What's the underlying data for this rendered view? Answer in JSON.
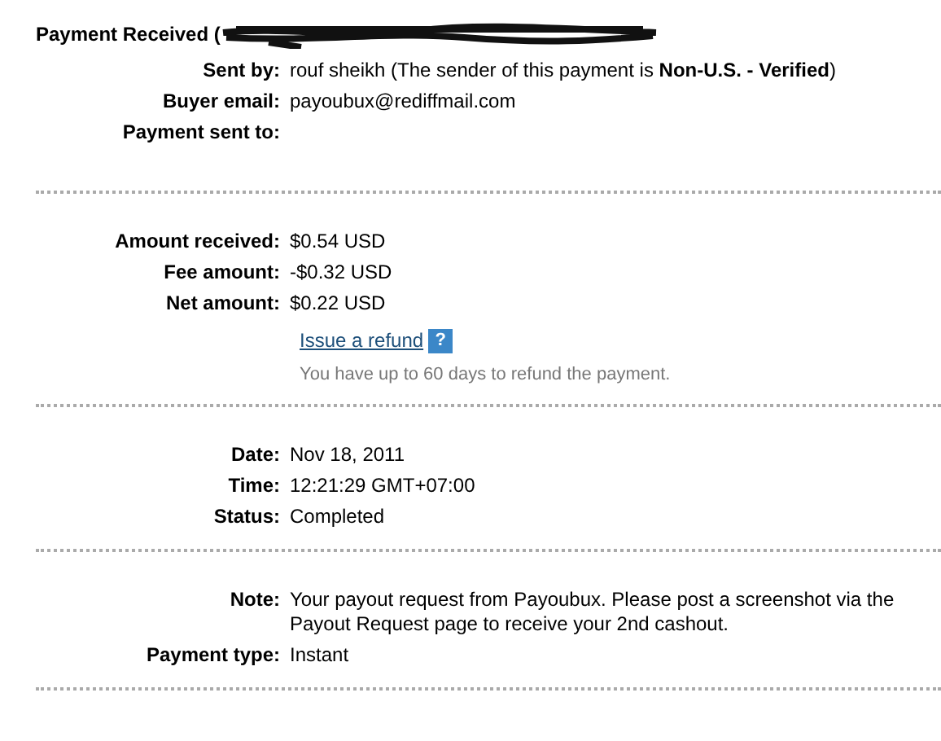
{
  "title": "Payment Received (",
  "sections": [
    {
      "rows": [
        {
          "kind": "field",
          "label": "Sent by:",
          "value": "rouf sheikh (The sender of this payment is **Non-U.S. - Verified**)"
        },
        {
          "kind": "field",
          "label": "Buyer email:",
          "value": "payoubux@rediffmail.com"
        },
        {
          "kind": "field",
          "label": "Payment sent to:"
        }
      ]
    },
    {
      "rows": [
        {
          "kind": "field",
          "label": "Amount received:",
          "value": "$0.54 USD"
        },
        {
          "kind": "field",
          "label": "Fee amount:",
          "value": "-$0.32 USD"
        },
        {
          "kind": "field",
          "label": "Net amount:",
          "value": "$0.22 USD"
        },
        {
          "kind": "refund",
          "link": "Issue a refund",
          "help": "?",
          "hint": "You have up to 60 days to refund the payment."
        }
      ]
    },
    {
      "rows": [
        {
          "kind": "field",
          "label": "Date:",
          "value": "Nov 18, 2011"
        },
        {
          "kind": "field",
          "label": "Time:",
          "value": "12:21:29 GMT+07:00"
        },
        {
          "kind": "field",
          "label": "Status:",
          "value": "Completed"
        }
      ]
    },
    {
      "rows": [
        {
          "kind": "field",
          "label": "Note:",
          "value": "Your payout request from Payoubux. Please post a screenshot via the Payout Request page to receive your 2nd cashout."
        },
        {
          "kind": "field",
          "label": "Payment type:",
          "value": "Instant"
        }
      ]
    }
  ]
}
